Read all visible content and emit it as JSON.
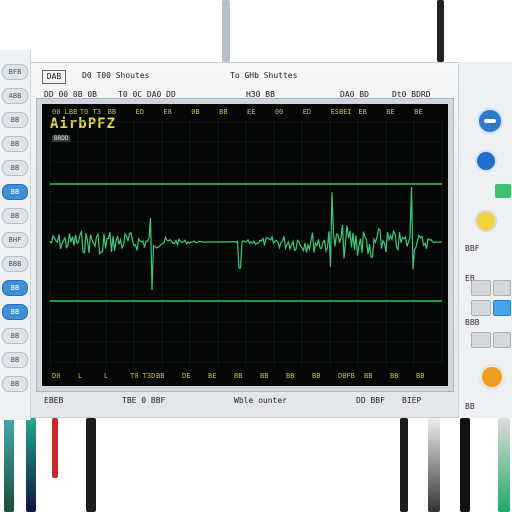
{
  "header": {
    "left_box": "DAB",
    "left_label": "D0 T00 Shoutes",
    "center_label": "To GHb Shuttes",
    "readouts": [
      "DD 00 0B 0B",
      "T0 0C DA0 DD",
      "H30 BB",
      "DA0 BD",
      "Dt0 BDRD"
    ]
  },
  "screen": {
    "badge": "AirbPFZ",
    "sub_badge": "BRDD",
    "top_ticks": [
      "00 LBB",
      "T0 T3",
      "BB",
      "ED",
      "E8",
      "0B",
      "BB",
      "EE",
      "00",
      "ED",
      "ESBEI",
      "EB",
      "BE",
      "BE"
    ],
    "bottom_ticks": [
      "D0",
      "L",
      "L",
      "T0 T3D",
      "BB",
      "DE",
      "BE",
      "BB",
      "BB",
      "BB",
      "BB",
      "DBFB",
      "BB",
      "BB",
      "BB"
    ],
    "trace_color": "#3ec779",
    "baseline_color": "#3bbf6a"
  },
  "footer": {
    "left": "EBEB",
    "center_left": "TBE 0 BBF",
    "center": "Wble ounter",
    "right_a": "DD BBF",
    "right_b": "BIEP"
  },
  "left_buttons": [
    "BFB",
    "ABB",
    "BB",
    "BB",
    "BB",
    "BB",
    "BB",
    "BHF",
    "BBB",
    "BB",
    "BB",
    "BB",
    "BB",
    "BB"
  ],
  "right_panel": {
    "labels": [
      "BBF",
      "EB",
      "BBB",
      "BB"
    ]
  }
}
